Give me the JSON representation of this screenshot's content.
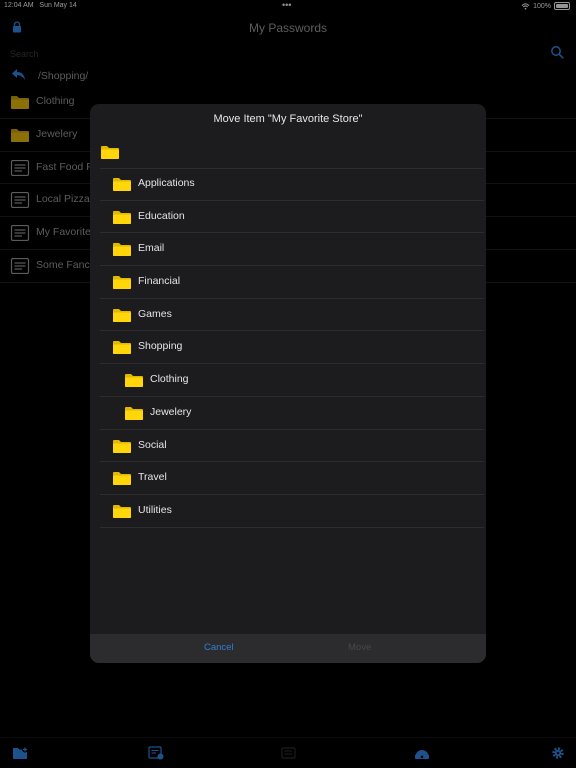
{
  "statusbar": {
    "time": "12:04 AM",
    "date": "Sun May 14",
    "dots": "•••",
    "battery": "100%"
  },
  "header": {
    "title": "My Passwords"
  },
  "search": {
    "placeholder": "Search"
  },
  "path": "/Shopping/",
  "list": [
    {
      "type": "folder",
      "label": "Clothing"
    },
    {
      "type": "folder",
      "label": "Jewelery"
    },
    {
      "type": "note",
      "label": "Fast Food P"
    },
    {
      "type": "note",
      "label": "Local Pizza"
    },
    {
      "type": "note",
      "label": "My Favorite"
    },
    {
      "type": "note",
      "label": "Some Fanc"
    }
  ],
  "modal": {
    "title": "Move Item \"My Favorite Store\"",
    "folders": [
      {
        "label": "Applications",
        "level": 0
      },
      {
        "label": "Education",
        "level": 0
      },
      {
        "label": "Email",
        "level": 0
      },
      {
        "label": "Financial",
        "level": 0
      },
      {
        "label": "Games",
        "level": 0
      },
      {
        "label": "Shopping",
        "level": 0
      },
      {
        "label": "Clothing",
        "level": 1
      },
      {
        "label": "Jewelery",
        "level": 1
      },
      {
        "label": "Social",
        "level": 0
      },
      {
        "label": "Travel",
        "level": 0
      },
      {
        "label": "Utilities",
        "level": 0
      }
    ],
    "cancel_label": "Cancel",
    "move_label": "Move"
  },
  "colors": {
    "accent": "#2f7fd9",
    "folder": "#ffd60a",
    "background": "#000000",
    "modal": "#1c1c1e"
  },
  "icons": [
    "lock-icon",
    "search-icon",
    "back-arrow-icon",
    "folder-icon",
    "note-icon",
    "folder-plus-icon",
    "new-item-icon",
    "edit-icon",
    "sync-icon",
    "gear-icon"
  ]
}
